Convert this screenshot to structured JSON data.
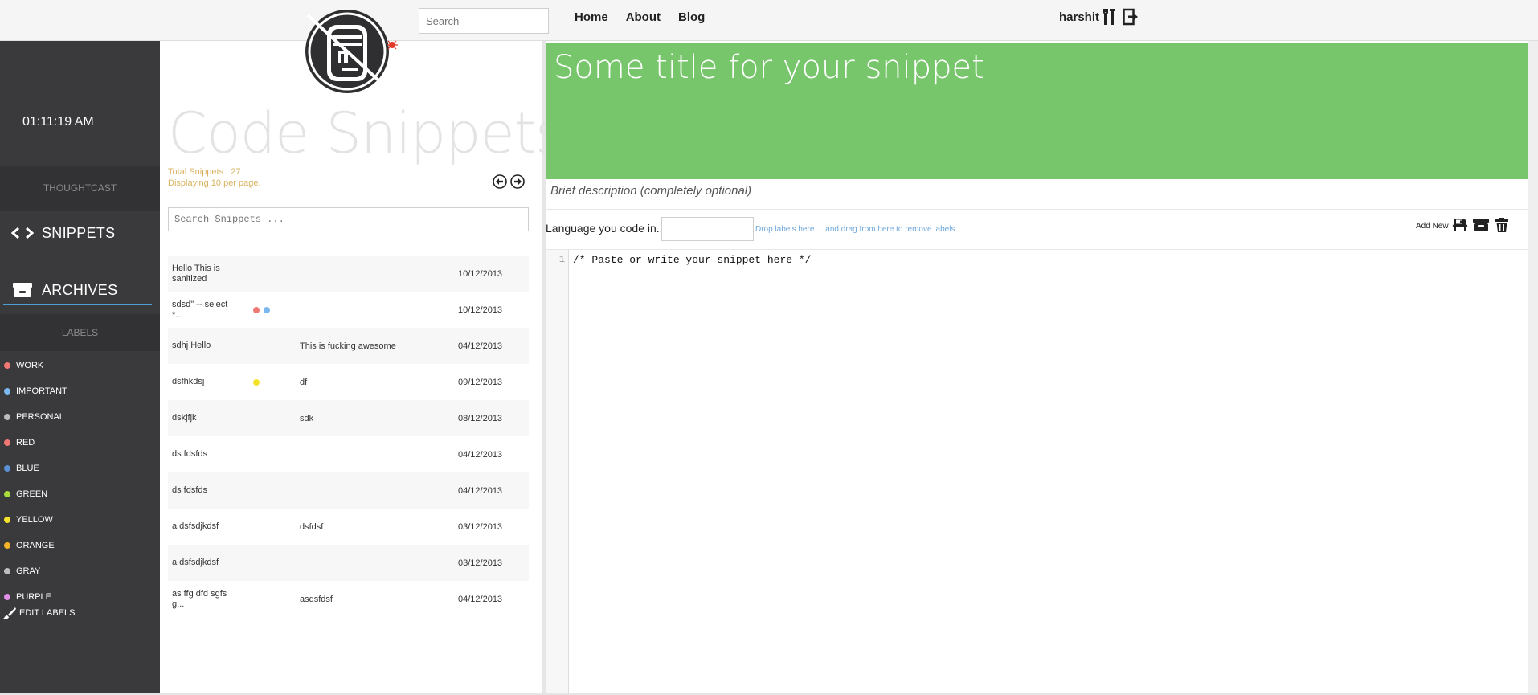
{
  "header": {
    "search_placeholder": "Search",
    "nav": [
      "Home",
      "About",
      "Blog"
    ],
    "username": "harshit"
  },
  "sidebar": {
    "clock": "01:11:19 AM",
    "section_thoughtcast": "THOUGHTCAST",
    "nav_snippets": "SNIPPETS",
    "nav_archives": "ARCHIVES",
    "labels_heading": "LABELS",
    "labels": [
      {
        "name": "WORK",
        "color": "#f07873"
      },
      {
        "name": "IMPORTANT",
        "color": "#7ab8ef"
      },
      {
        "name": "PERSONAL",
        "color": "#bcbcbc"
      },
      {
        "name": "RED",
        "color": "#f07873"
      },
      {
        "name": "BLUE",
        "color": "#5b8fd6"
      },
      {
        "name": "GREEN",
        "color": "#a8dd3a"
      },
      {
        "name": "YELLOW",
        "color": "#f5e22a"
      },
      {
        "name": "ORANGE",
        "color": "#f5b327"
      },
      {
        "name": "GRAY",
        "color": "#bdbdbd"
      },
      {
        "name": "PURPLE",
        "color": "#e08ee6"
      }
    ],
    "edit_labels": "EDIT LABELS"
  },
  "list": {
    "title": "Code Snippets",
    "total": "Total Snippets : 27",
    "per_page": "Displaying 10 per page.",
    "search_placeholder": "Search Snippets ...",
    "rows": [
      {
        "title": "Hello This is sanitized",
        "dots": [],
        "desc": "",
        "date": "10/12/2013"
      },
      {
        "title": "sdsd\" -- select *...",
        "dots": [
          "#f07873",
          "#7ab8ef"
        ],
        "desc": "",
        "date": "10/12/2013"
      },
      {
        "title": "sdhj Hello",
        "dots": [],
        "desc": "This is fucking awesome",
        "date": "04/12/2013"
      },
      {
        "title": "dsfhkdsj",
        "dots": [
          "#f5e22a"
        ],
        "desc": "df",
        "date": "09/12/2013"
      },
      {
        "title": "dskjfjk",
        "dots": [],
        "desc": "sdk",
        "date": "08/12/2013"
      },
      {
        "title": "ds fdsfds",
        "dots": [],
        "desc": "",
        "date": "04/12/2013"
      },
      {
        "title": "ds fdsfds",
        "dots": [],
        "desc": "",
        "date": "04/12/2013"
      },
      {
        "title": "a dsfsdjkdsf",
        "dots": [],
        "desc": "dsfdsf",
        "date": "03/12/2013"
      },
      {
        "title": "a dsfsdjkdsf",
        "dots": [],
        "desc": "",
        "date": "03/12/2013"
      },
      {
        "title": "as ffg dfd sgfs g...",
        "dots": [],
        "desc": "asdsfdsf",
        "date": "04/12/2013"
      }
    ]
  },
  "editor": {
    "title": "Some title for your snippet",
    "description": "Brief description (completely optional)",
    "language_label": "Language you code in...",
    "drop_hint": "Drop labels here ... and drag from here to remove labels",
    "add_new": "Add New",
    "line_number": "1",
    "code": "/* Paste or write your snippet here */",
    "banner_color": "#77c66b"
  }
}
